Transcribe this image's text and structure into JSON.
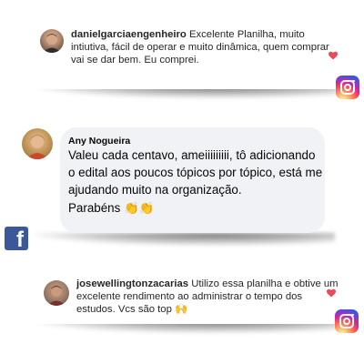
{
  "comments": [
    {
      "platform": "instagram",
      "username": "danielgarciaengenheiro",
      "text": " Excelente Planilha, muito intiutiva, fácil de operar e muito dinâmica, quem comprar vai se dar bem. Eu comprei.",
      "icon": "heart-icon"
    },
    {
      "platform": "facebook",
      "username": "Any Nogueira",
      "text": "Valeu cada centavo, ameiiiiiiiii, tô adicionando o edital aos poucos tópicos por tópico, está me ajudando muito na organização.",
      "closing": "Parabéns 👏👏"
    },
    {
      "platform": "instagram",
      "username": "josewellingtonzacarias",
      "text": " Utilizo essa planilha e obtive um excelente rendimento ao administrar o tempo dos estudos. Vcs são top 🙌",
      "icon": "heart-icon"
    }
  ],
  "colors": {
    "heart": "#ed4956",
    "facebook": "#3b5998",
    "bubble": "#f0f2f5"
  }
}
